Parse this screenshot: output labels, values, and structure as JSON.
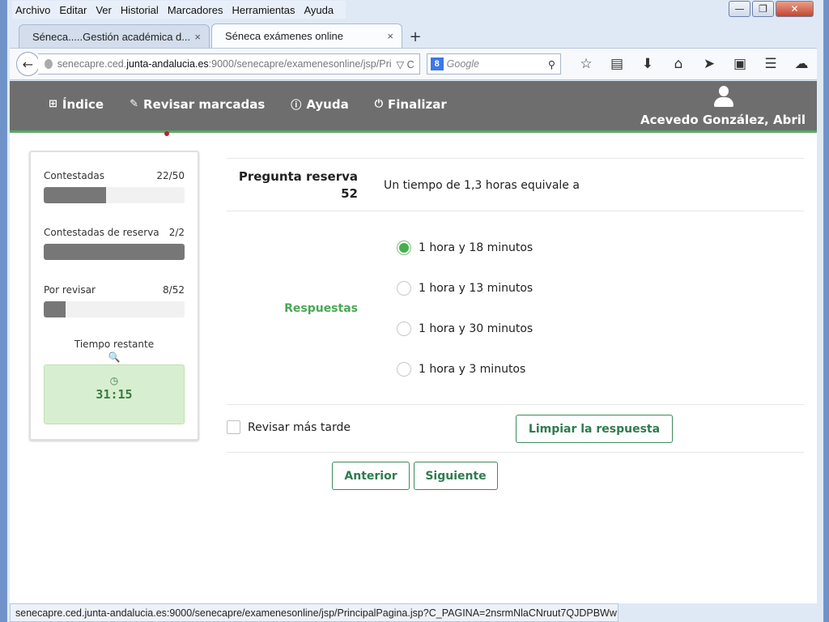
{
  "browser": {
    "menu": [
      "Archivo",
      "Editar",
      "Ver",
      "Historial",
      "Marcadores",
      "Herramientas",
      "Ayuda"
    ],
    "window_controls": {
      "min": "—",
      "max": "❐",
      "close": "✕"
    },
    "tabs": [
      {
        "label": "Séneca.....Gestión académica d...",
        "close": "×"
      },
      {
        "label": "Séneca exámenes online",
        "close": "×"
      }
    ],
    "new_tab": "+",
    "url": {
      "pre": "senecapre.ced.",
      "domain": "junta-andalucia.es",
      "post": ":9000/senecapre/examenesonline/jsp/Pri",
      "controls": "▽ C"
    },
    "search": {
      "engine": "8",
      "placeholder": "Google"
    },
    "status_url": "senecapre.ced.junta-andalucia.es:9000/senecapre/examenesonline/jsp/PrincipalPagina.jsp?C_PAGINA=2nsrmNlaCNruut7QJDPBWw"
  },
  "app": {
    "nav": [
      {
        "icon": "sitemap-icon",
        "glyph": "⊞",
        "label": "Índice"
      },
      {
        "icon": "pencil-icon",
        "glyph": "✎",
        "label": "Revisar marcadas"
      },
      {
        "icon": "info-icon",
        "glyph": "ⓘ",
        "label": "Ayuda"
      },
      {
        "icon": "power-icon",
        "glyph": "⏻",
        "label": "Finalizar"
      }
    ],
    "user_name": "Acevedo González, Abril",
    "accent": "#4aa755"
  },
  "sidebar": {
    "stats": [
      {
        "label": "Contestadas",
        "count": "22/50",
        "fraction": 0.44
      },
      {
        "label": "Contestadas de reserva",
        "count": "2/2",
        "fraction": 1.0
      },
      {
        "label": "Por revisar",
        "count": "8/52",
        "fraction": 0.154
      }
    ],
    "tiempo_label": "Tiempo restante",
    "zoom_glyph": "🔍",
    "clock_glyph": "◷",
    "timer": "31:15"
  },
  "question": {
    "title_line1": "Pregunta reserva",
    "title_line2": "52",
    "text": "Un tiempo de 1,3 horas equivale a",
    "answers_label": "Respuestas",
    "options": [
      {
        "label": "1 hora y 18 minutos",
        "selected": true
      },
      {
        "label": "1 hora y 13 minutos",
        "selected": false
      },
      {
        "label": "1 hora y 30 minutos",
        "selected": false
      },
      {
        "label": "1 hora y 3 minutos",
        "selected": false
      }
    ],
    "review_later": "Revisar más tarde",
    "clear_button": "Limpiar la respuesta",
    "prev_button": "Anterior",
    "next_button": "Siguiente"
  }
}
